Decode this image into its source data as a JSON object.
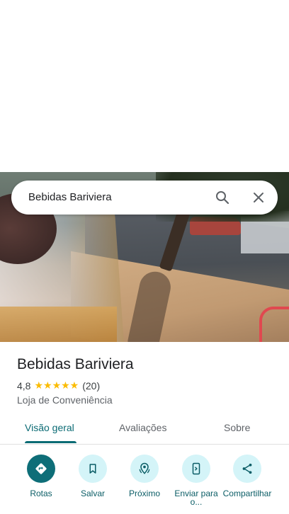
{
  "search": {
    "query": "Bebidas Bariviera",
    "search_icon": "search-icon",
    "close_icon": "close-icon"
  },
  "place": {
    "name": "Bebidas Bariviera",
    "rating": "4,8",
    "stars": "★★★★★",
    "star_count": 5,
    "reviews": "(20)",
    "category": "Loja de Conveniência"
  },
  "tabs": [
    {
      "label": "Visão geral",
      "active": true
    },
    {
      "label": "Avaliações",
      "active": false
    },
    {
      "label": "Sobre",
      "active": false
    }
  ],
  "actions": [
    {
      "label": "Rotas",
      "icon": "directions-icon"
    },
    {
      "label": "Salvar",
      "icon": "bookmark-icon"
    },
    {
      "label": "Próximo",
      "icon": "nearby-icon"
    },
    {
      "label": "Enviar para o...",
      "icon": "send-to-phone-icon"
    },
    {
      "label": "Compartilhar",
      "icon": "share-icon"
    }
  ],
  "colors": {
    "accent": "#0b6b74",
    "primary_button": "#0e6e78",
    "action_bg": "#d4f4f8",
    "star": "#fbbc04"
  }
}
